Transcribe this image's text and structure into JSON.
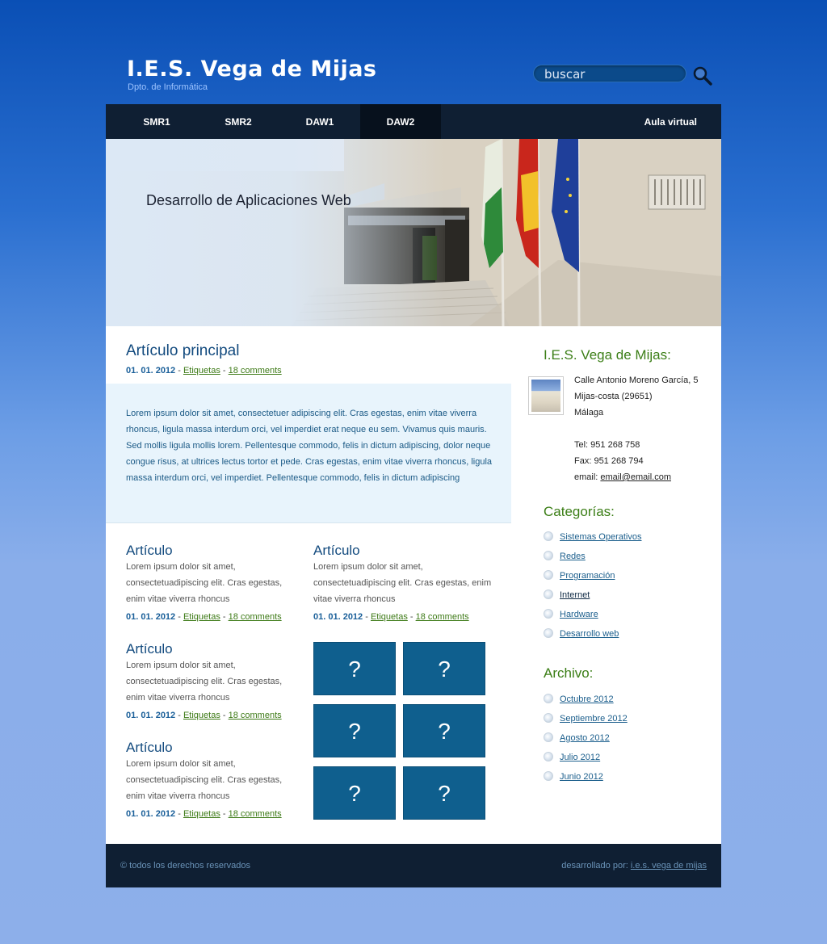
{
  "header": {
    "site_title": "I.E.S. Vega de Mijas",
    "subtitle": "Dpto. de Informática",
    "search_placeholder": "buscar"
  },
  "nav": {
    "items": [
      "SMR1",
      "SMR2",
      "DAW1",
      "DAW2"
    ],
    "active": "DAW2",
    "aula": "Aula virtual"
  },
  "hero": {
    "title": "Desarrollo de Aplicaciones Web"
  },
  "main_article": {
    "title": "Artículo principal",
    "date": "01. 01. 2012",
    "tags": "Etiquetas",
    "comments": "18 comments",
    "body": "Lorem ipsum dolor sit amet, consectetuer adipiscing elit. Cras egestas, enim vitae viverra rhoncus, ligula massa interdum orci, vel imperdiet erat neque eu sem. Vivamus quis mauris. Sed mollis ligula mollis lorem. Pellentesque commodo, felis in dictum adipiscing, dolor neque congue risus, at ultrices lectus tortor et pede. Cras egestas, enim vitae viverra rhoncus, ligula massa interdum orci, vel imperdiet. Pellentesque commodo, felis in dictum adipiscing"
  },
  "articles": [
    {
      "title": "Artículo",
      "excerpt": "Lorem ipsum dolor sit amet, consectetuadipiscing elit. Cras egestas, enim vitae viverra rhoncus",
      "date": "01. 01. 2012",
      "tags": "Etiquetas",
      "comments": "18 comments"
    },
    {
      "title": "Artículo",
      "excerpt": "Lorem ipsum dolor sit amet, consectetuadipiscing elit. Cras egestas, enim vitae viverra rhoncus",
      "date": "01. 01. 2012",
      "tags": "Etiquetas",
      "comments": "18 comments"
    },
    {
      "title": "Artículo",
      "excerpt": "Lorem ipsum dolor sit amet, consectetuadipiscing elit. Cras egestas, enim vitae viverra rhoncus",
      "date": "01. 01. 2012",
      "tags": "Etiquetas",
      "comments": "18 comments"
    },
    {
      "title": "Artículo",
      "excerpt": "Lorem ipsum dolor sit amet, consectetuadipiscing elit. Cras egestas, enim vitae viverra rhoncus",
      "date": "01. 01. 2012",
      "tags": "Etiquetas",
      "comments": "18 comments"
    }
  ],
  "gallery": [
    "?",
    "?",
    "?",
    "?",
    "?",
    "?"
  ],
  "sidebar": {
    "contact_title": "I.E.S. Vega de Mijas:",
    "address1": "Calle Antonio Moreno García, 5",
    "address2": "Mijas-costa (29651)",
    "address3": "Málaga",
    "tel": "Tel: 951 268 758",
    "fax": "Fax: 951 268 794",
    "email_label": "email: ",
    "email": "email@email.com",
    "categories_title": "Categorías:",
    "categories": [
      "Sistemas Operativos",
      "Redes",
      "Programación",
      "Internet",
      "Hardware",
      "Desarrollo web"
    ],
    "archive_title": "Archivo:",
    "archive": [
      "Octubre 2012",
      "Septiembre 2012",
      "Agosto 2012",
      "Julio 2012",
      "Junio 2012"
    ]
  },
  "footer": {
    "left": "© todos los derechos reservados",
    "right_label": "desarrollado por: ",
    "right_link": "i.e.s. vega de mijas"
  },
  "colors": {
    "nav_bg": "#0f1f33",
    "accent_blue": "#124a7e",
    "accent_green": "#3b7e16",
    "thumb_bg": "#0f5f8e"
  }
}
